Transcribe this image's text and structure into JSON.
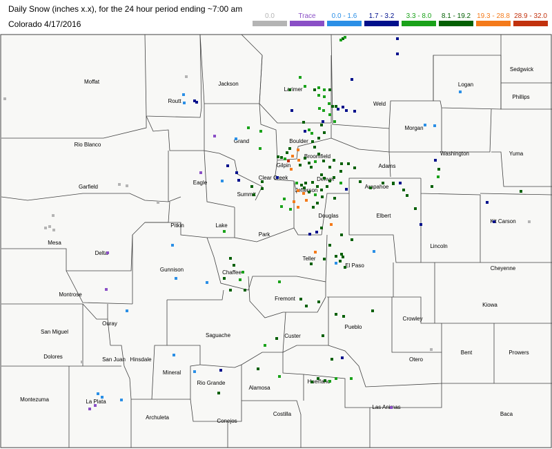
{
  "header": {
    "title": "Daily Snow (inches  x.x),  for the 24 hour period ending ~7:00 am",
    "subtitle": "Colorado 4/17/2016"
  },
  "legend": [
    {
      "label": "0.0",
      "color": "#b4b4b4"
    },
    {
      "label": "Trace",
      "color": "#8a4fc6"
    },
    {
      "label": "0.0 - 1.6",
      "color": "#2b8fe6"
    },
    {
      "label": "1.7 - 3.2",
      "color": "#00108c"
    },
    {
      "label": "3.3 - 8.0",
      "color": "#1aa21a"
    },
    {
      "label": "8.1 - 19.2",
      "color": "#046004"
    },
    {
      "label": "19.3 - 28.8",
      "color": "#f47a1a"
    },
    {
      "label": "28.9 - 32.0",
      "color": "#c2320e"
    }
  ],
  "counties": [
    "Moffat",
    "Jackson",
    "Larimer",
    "Logan",
    "Sedgwick",
    "Phillips",
    "Routt",
    "Weld",
    "Morgan",
    "Rio Blanco",
    "Grand",
    "Boulder",
    "Washington",
    "Yuma",
    "Broomfield",
    "Gilpin",
    "Adams",
    "Garfield",
    "Eagle",
    "Clear Creek",
    "Summit",
    "Denver",
    "Jefferson",
    "Arapahoe",
    "Douglas",
    "Elbert",
    "Kit Carson",
    "Mesa",
    "Pitkin",
    "Lake",
    "Park",
    "Delta",
    "Lincoln",
    "Teller",
    "El Paso",
    "Gunnison",
    "Chaffee",
    "Cheyenne",
    "Montrose",
    "Fremont",
    "Kiowa",
    "Ouray",
    "Pueblo",
    "Crowley",
    "San Miguel",
    "Saguache",
    "Custer",
    "Dolores",
    "San Juan",
    "Hinsdale",
    "Otero",
    "Bent",
    "Prowers",
    "Mineral",
    "Rio Grande",
    "Alamosa",
    "Huerfano",
    "Montezuma",
    "La Plata",
    "Archuleta",
    "Conejos",
    "Costilla",
    "Las Animas",
    "Baca"
  ]
}
